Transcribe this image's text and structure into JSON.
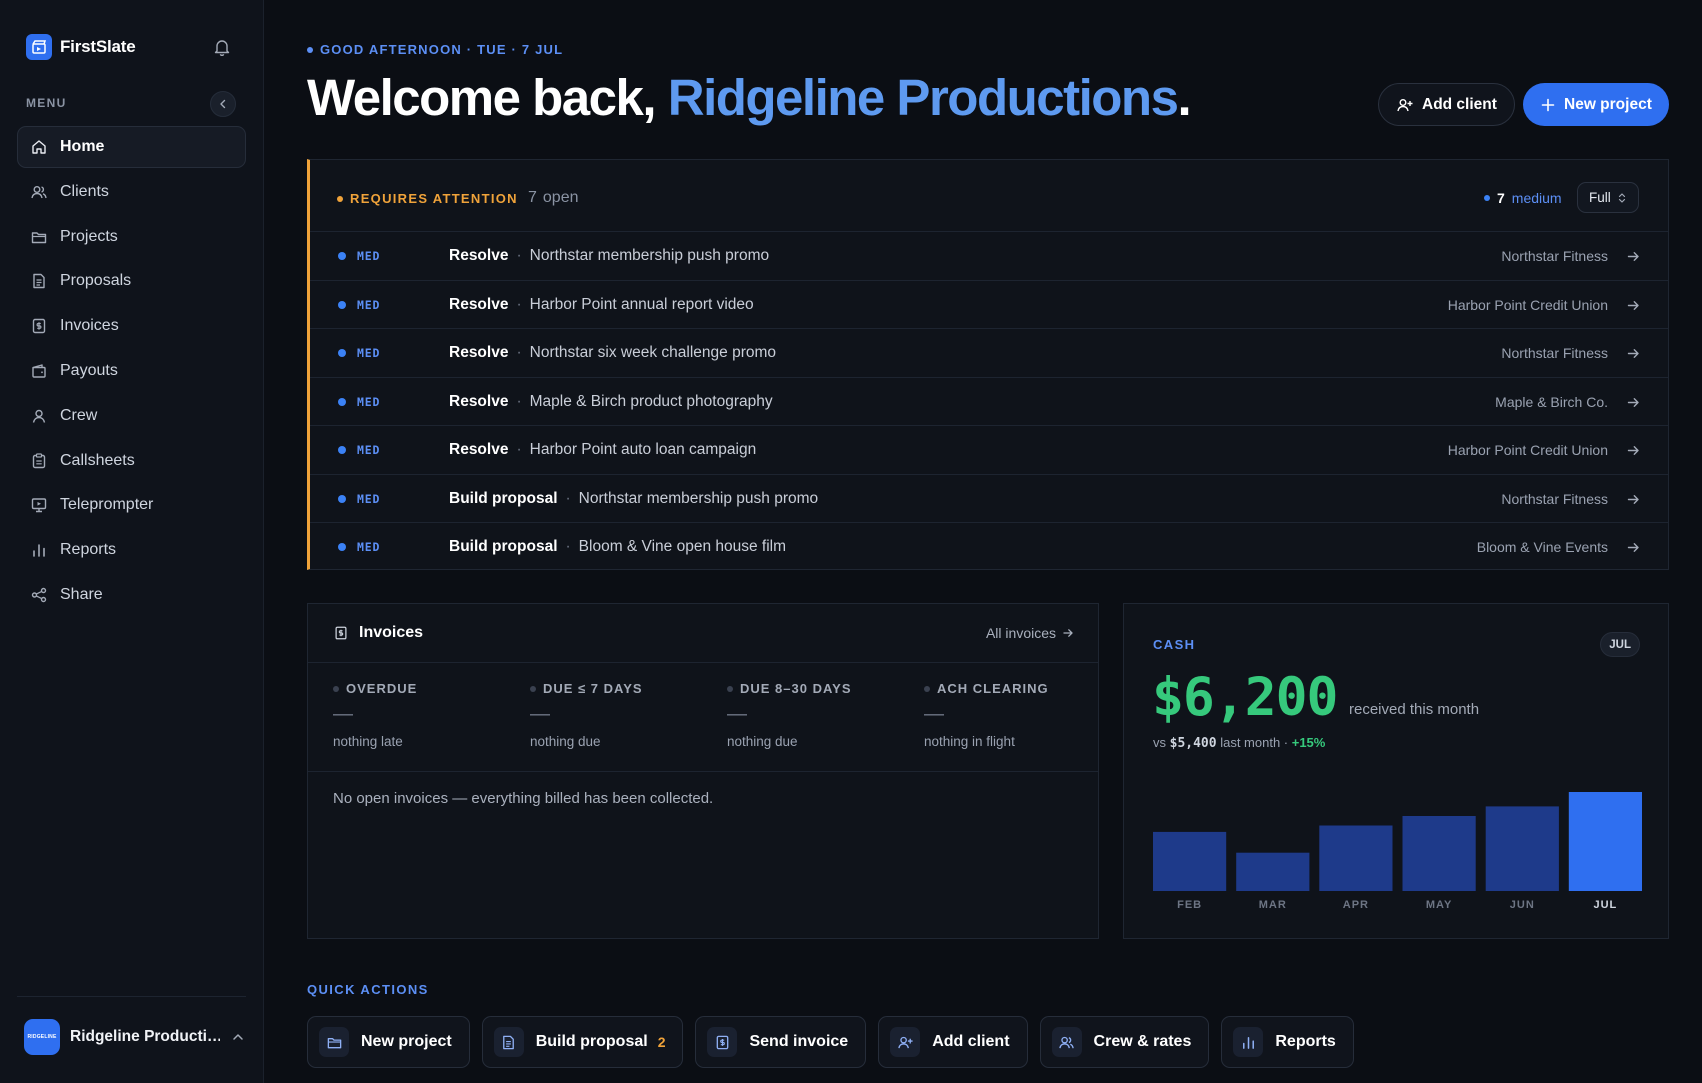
{
  "app": {
    "name": "FirstSlate",
    "menu_label": "MENU",
    "account_name": "Ridgeline Producti…",
    "account_avatar_text": "RIDGELINE"
  },
  "sidebar": {
    "items": [
      {
        "label": "Home",
        "icon": "home-icon",
        "active": true
      },
      {
        "label": "Clients",
        "icon": "users-icon"
      },
      {
        "label": "Projects",
        "icon": "folder-icon"
      },
      {
        "label": "Proposals",
        "icon": "document-icon"
      },
      {
        "label": "Invoices",
        "icon": "dollar-doc-icon"
      },
      {
        "label": "Payouts",
        "icon": "wallet-icon"
      },
      {
        "label": "Crew",
        "icon": "user-icon"
      },
      {
        "label": "Callsheets",
        "icon": "clipboard-icon"
      },
      {
        "label": "Teleprompter",
        "icon": "monitor-icon"
      },
      {
        "label": "Reports",
        "icon": "bar-chart-icon"
      },
      {
        "label": "Share",
        "icon": "share-icon"
      }
    ]
  },
  "header": {
    "greeting": "GOOD AFTERNOON · TUE · 7 JUL",
    "welcome_prefix": "Welcome back, ",
    "welcome_name": "Ridgeline Productions",
    "welcome_suffix": ".",
    "add_client_label": "Add client",
    "new_project_label": "New project"
  },
  "attention": {
    "title": "REQUIRES ATTENTION",
    "open_count": "7",
    "open_label": "open",
    "filter_count": "7",
    "filter_label": "medium",
    "view_select": "Full",
    "rows": [
      {
        "severity": "MED",
        "action": "Resolve",
        "item": "Northstar membership push promo",
        "client": "Northstar Fitness"
      },
      {
        "severity": "MED",
        "action": "Resolve",
        "item": "Harbor Point annual report video",
        "client": "Harbor Point Credit Union"
      },
      {
        "severity": "MED",
        "action": "Resolve",
        "item": "Northstar six week challenge promo",
        "client": "Northstar Fitness"
      },
      {
        "severity": "MED",
        "action": "Resolve",
        "item": "Maple & Birch product photography",
        "client": "Maple & Birch Co."
      },
      {
        "severity": "MED",
        "action": "Resolve",
        "item": "Harbor Point auto loan campaign",
        "client": "Harbor Point Credit Union"
      },
      {
        "severity": "MED",
        "action": "Build proposal",
        "item": "Northstar membership push promo",
        "client": "Northstar Fitness"
      },
      {
        "severity": "MED",
        "action": "Build proposal",
        "item": "Bloom & Vine open house film",
        "client": "Bloom & Vine Events"
      }
    ]
  },
  "invoices": {
    "title": "Invoices",
    "all_link": "All invoices",
    "stats": [
      {
        "label": "OVERDUE",
        "value": "—",
        "sub": "nothing late"
      },
      {
        "label": "DUE ≤ 7 DAYS",
        "value": "—",
        "sub": "nothing due"
      },
      {
        "label": "DUE 8–30 DAYS",
        "value": "—",
        "sub": "nothing due"
      },
      {
        "label": "ACH CLEARING",
        "value": "—",
        "sub": "nothing in flight"
      }
    ],
    "empty_message": "No open invoices — everything billed has been collected."
  },
  "cash": {
    "label": "CASH",
    "month_badge": "JUL",
    "amount": "$6,200",
    "caption": "received this month",
    "compare_prefix": "vs ",
    "compare_value": "$5,400",
    "compare_mid": " last month · ",
    "compare_delta": "+15%"
  },
  "chart_data": {
    "type": "bar",
    "categories": [
      "FEB",
      "MAR",
      "APR",
      "MAY",
      "JUN",
      "JUL"
    ],
    "values": [
      3700,
      2400,
      4100,
      4700,
      5300,
      6200
    ],
    "ylim": [
      0,
      6200
    ],
    "highlight": "JUL",
    "colors": {
      "bar": "#1e3a8a",
      "highlight": "#2f6ff0"
    }
  },
  "quick_actions": {
    "label": "QUICK ACTIONS",
    "items": [
      {
        "label": "New project",
        "icon": "folder-icon"
      },
      {
        "label": "Build proposal",
        "icon": "document-icon",
        "badge": "2"
      },
      {
        "label": "Send invoice",
        "icon": "dollar-doc-icon"
      },
      {
        "label": "Add client",
        "icon": "add-user-icon"
      },
      {
        "label": "Crew & rates",
        "icon": "users-icon"
      },
      {
        "label": "Reports",
        "icon": "bar-chart-icon"
      }
    ]
  },
  "colors": {
    "accent": "#2f6ff0",
    "attention": "#f0a33a",
    "positive": "#36c97c"
  }
}
